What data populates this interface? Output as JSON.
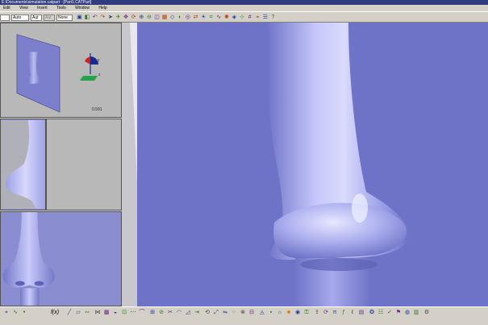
{
  "window": {
    "title": "E:\\Documents\\simulation.catpart - [Part1.CATPart]"
  },
  "menu": {
    "items": [
      "Edit",
      "View",
      "Insert",
      "Tools",
      "Window",
      "Help"
    ]
  },
  "toolbar": {
    "combos": [
      {
        "name": "color-combo",
        "value": "",
        "disabled": false
      },
      {
        "name": "transparency-combo",
        "value": "Auto",
        "disabled": false
      },
      {
        "name": "line-weight-combo",
        "value": "Aut",
        "disabled": false
      },
      {
        "name": "line-type-combo",
        "value": "Aut",
        "disabled": true
      },
      {
        "name": "layer-combo",
        "value": "None",
        "disabled": false
      }
    ],
    "icons": [
      "sketch-icon",
      "pad-icon",
      "undo-icon",
      "redo-icon",
      "select-icon",
      "fly-icon",
      "pan-icon",
      "rotate-icon",
      "zoom-in-icon",
      "zoom-out-icon",
      "normal-view-icon",
      "multi-view-icon",
      "iso-view-icon",
      "shading-icon",
      "hide-show-icon",
      "swap-icon",
      "render-icon",
      "measure-icon",
      "analysis-icon",
      "light-icon",
      "material-icon",
      "snap-icon",
      "grid-icon",
      "compass-icon",
      "tree-icon",
      "help-icon"
    ]
  },
  "views": {
    "top_left_scale": "0.591"
  },
  "bottom_toolbar": {
    "fx_label": "f(x)",
    "icons": [
      "measure-icon",
      "curve-icon",
      "point-icon",
      "line-icon",
      "plane-icon",
      "spline-icon",
      "blend-icon",
      "fill-icon",
      "surface-icon",
      "offset-icon",
      "sweep-icon",
      "loft-icon",
      "join-icon",
      "split-icon",
      "trim-icon",
      "fillet-icon",
      "chamfer-icon",
      "translate-icon",
      "rotate-icon",
      "scale-icon",
      "mirror-icon",
      "pattern-icon",
      "boolean-icon",
      "section-icon",
      "analysis-icon",
      "color-icon",
      "render-icon",
      "orange-box-icon",
      "quick-view-icon",
      "lock-icon",
      "publish-icon",
      "sync-icon",
      "parameter-icon",
      "formula-icon",
      "law-icon",
      "design-table-icon",
      "knowledge-icon",
      "rule-icon",
      "check-icon",
      "reaction-icon",
      "spec-icon",
      "catalog-icon",
      "settings-icon"
    ]
  },
  "colors": {
    "viewport_bg": "#6f73c8",
    "surface": "#b7b9ee",
    "chrome": "#d4d0c8",
    "titlebar": "#2f3c7e"
  }
}
